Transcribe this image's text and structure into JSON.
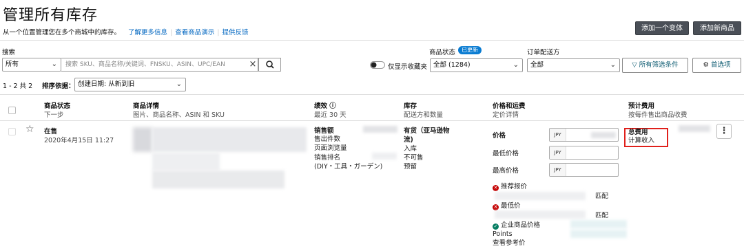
{
  "page": {
    "title": "管理所有库存",
    "subtitle": "从一个位置管理您在多个商城中的库存。",
    "links": [
      "了解更多信息",
      "查看商品演示",
      "提供反馈"
    ],
    "buttons": {
      "add_variation": "添加一个变体",
      "add_product": "添加新商品"
    }
  },
  "filters": {
    "search_label": "搜索",
    "search_scope": "所有",
    "search_placeholder": "搜索 SKU、商品名称/关键词、FNSKU、ASIN、UPC/EAN",
    "clear_icon": "×",
    "hide_label": "仅显示收藏夹",
    "status_label": "商品状态",
    "status_badge": "已更新",
    "status_value": "全部 (1284)",
    "fulfillment_label": "订单配送方",
    "fulfillment_value": "全部",
    "all_filters": "所有筛选条件",
    "preferences": "首选项"
  },
  "list_bar": {
    "range": "1 - 2 共 2",
    "sort_label": "排序依据：",
    "sort_value": "创建日期: 从新到旧"
  },
  "columns": [
    {
      "main": "商品状态",
      "sub": "下一步"
    },
    {
      "main": "商品详情",
      "sub": "图片、商品名称、ASIN 和 SKU"
    },
    {
      "main": "绩效 ⓘ",
      "sub": "最近 30 天"
    },
    {
      "main": "库存",
      "sub": "配送方和数量"
    },
    {
      "main": "价格和运费",
      "sub": "定价详情"
    },
    {
      "main": "预计费用",
      "sub": "按每件售出商品收费"
    }
  ],
  "row": {
    "status": "在售",
    "date": "2020年4月15日 11:27",
    "performance": [
      "销售额",
      "售出件数",
      "页面浏览量",
      "销售排名",
      "(DIY・工具・ガーデン)"
    ],
    "inventory_title_1": "有货（亚马逊物",
    "inventory_title_2": "流)",
    "inventory_items": [
      "入库",
      "不可售",
      "预留"
    ],
    "price_label": "价格",
    "min_price_label": "最低价格",
    "max_price_label": "最高价格",
    "currency": "JPY",
    "recommended_price": "推荐报价",
    "lowest_price": "最低价",
    "match_link": "匹配",
    "business_price": "企业商品价格",
    "points": "Points",
    "view_ref_price": "查看参考价",
    "fees_label": "总费用",
    "calc_income": "计算收入"
  }
}
